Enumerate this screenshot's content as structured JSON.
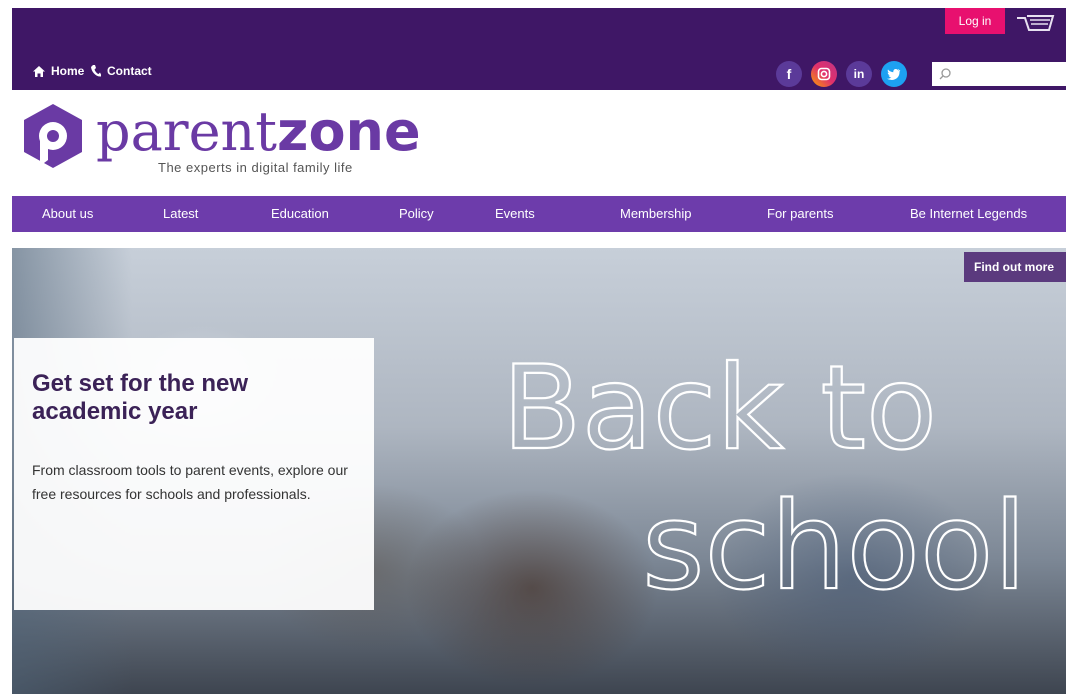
{
  "topbar": {
    "home_label": "Home",
    "contact_label": "Contact",
    "login_label": "Log in",
    "search_placeholder": "",
    "social": [
      "facebook-icon",
      "instagram-icon",
      "linkedin-icon",
      "twitter-icon"
    ]
  },
  "logo": {
    "parent": "parent",
    "zone": "zone",
    "tagline": "The experts in digital family life"
  },
  "nav": {
    "items": [
      "About us",
      "Latest",
      "Education",
      "Policy",
      "Events",
      "Membership",
      "For parents",
      "Be Internet Legends"
    ]
  },
  "hero": {
    "find_more": "Find out more",
    "title": "Get set for the new academic year",
    "body": "From classroom tools to parent events, explore our free resources for schools and professionals.",
    "chalk_line1": "Back to",
    "chalk_line2": "school"
  },
  "colors": {
    "topbar": "#3f1766",
    "nav": "#6d3cab",
    "brand": "#6a3aa4",
    "login": "#e8106f"
  }
}
